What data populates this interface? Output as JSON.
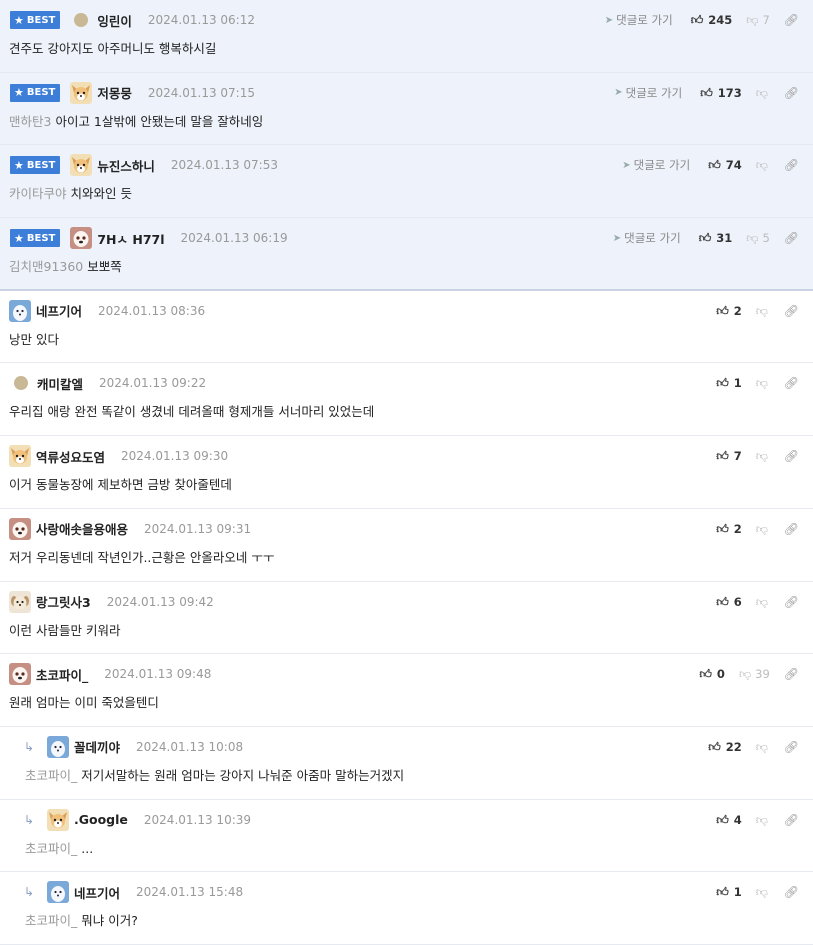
{
  "best_badge": "BEST",
  "goto_label": "댓글로 가기",
  "best_comments": [
    {
      "nick": "잉린이",
      "date": "2024.01.13 06:12",
      "quote": "",
      "text": "견주도 강아지도 아주머니도 행복하시길",
      "up": "245",
      "down": "7",
      "avatar": "dot"
    },
    {
      "nick": "저몽뭉",
      "date": "2024.01.13 07:15",
      "quote": "맨하탄3",
      "text": "아이고 1살밖에 안됐는데 말을 잘하네잉",
      "up": "173",
      "down": "",
      "avatar": "dog"
    },
    {
      "nick": "뉴진스하니",
      "date": "2024.01.13 07:53",
      "quote": "카이타쿠야",
      "text": "치와와인 듯",
      "up": "74",
      "down": "",
      "avatar": "dog"
    },
    {
      "nick": "7Hㅅ H77l",
      "date": "2024.01.13 06:19",
      "quote": "김치맨91360",
      "text": "보뽀쪽",
      "up": "31",
      "down": "5",
      "avatar": "red"
    }
  ],
  "comments": [
    {
      "nick": "네프기어",
      "date": "2024.01.13 08:36",
      "quote": "",
      "text": "낭만 있다",
      "up": "2",
      "down": "",
      "avatar": "snow",
      "reply": false
    },
    {
      "nick": "캐미칼엘",
      "date": "2024.01.13 09:22",
      "quote": "",
      "text": "우리집 애랑 완전 똑같이 생겼네 데려올때 형제개들 서너마리 있었는데",
      "up": "1",
      "down": "",
      "avatar": "dot",
      "reply": false
    },
    {
      "nick": "역류성요도염",
      "date": "2024.01.13 09:30",
      "quote": "",
      "text": "이거 동물농장에 제보하면 금방 찾아줄텐데",
      "up": "7",
      "down": "",
      "avatar": "dog",
      "reply": false
    },
    {
      "nick": "사랑애솟을용애용",
      "date": "2024.01.13 09:31",
      "quote": "",
      "text": "저거 우리동넨데 작년인가..근황은 안올라오네 ㅜㅜ",
      "up": "2",
      "down": "",
      "avatar": "red",
      "reply": false
    },
    {
      "nick": "랑그릿사3",
      "date": "2024.01.13 09:42",
      "quote": "",
      "text": "이런 사람들만 키워라",
      "up": "6",
      "down": "",
      "avatar": "pup",
      "reply": false
    },
    {
      "nick": "초코파이_",
      "date": "2024.01.13 09:48",
      "quote": "",
      "text": "원래 엄마는 이미 죽었을텐디",
      "up": "0",
      "down": "39",
      "avatar": "red",
      "reply": false
    },
    {
      "nick": "꼴데끼야",
      "date": "2024.01.13 10:08",
      "quote": "초코파이_",
      "text": "저기서말하는 원래 엄마는 강아지 나눠준 아줌마 말하는거겠지",
      "up": "22",
      "down": "",
      "avatar": "snow",
      "reply": true
    },
    {
      "nick": ".Google",
      "date": "2024.01.13 10:39",
      "quote": "초코파이_",
      "text": "...",
      "up": "4",
      "down": "",
      "avatar": "dog",
      "reply": true
    },
    {
      "nick": "네프기어",
      "date": "2024.01.13 15:48",
      "quote": "초코파이_",
      "text": "뭐냐 이거?",
      "up": "1",
      "down": "",
      "avatar": "snow",
      "reply": true
    }
  ]
}
